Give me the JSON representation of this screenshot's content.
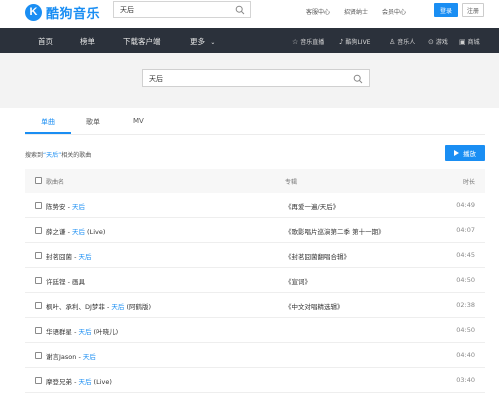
{
  "brand": {
    "logo_glyph": "K",
    "name": "酷狗音乐",
    "color": "#1a8ef3"
  },
  "top_search": {
    "value": "天后",
    "icon": "search-icon"
  },
  "top_links": [
    "客服中心",
    "招贤纳士",
    "会员中心"
  ],
  "auth": {
    "login": "登录",
    "register": "注册"
  },
  "nav": {
    "left": [
      "首页",
      "榜单",
      "下载客户端",
      "更多"
    ],
    "more_icon": "chevron-down-icon",
    "right": [
      {
        "icon": "star-icon",
        "glyph": "☆",
        "label": "音乐直播"
      },
      {
        "icon": "music-note-icon",
        "glyph": "♪",
        "label": "酷狗LIVE"
      },
      {
        "icon": "person-icon",
        "glyph": "♙",
        "label": "音乐人"
      },
      {
        "icon": "gamepad-icon",
        "glyph": "⊙",
        "label": "游戏"
      },
      {
        "icon": "mall-icon",
        "glyph": "▣",
        "label": "商城"
      }
    ]
  },
  "main_search": {
    "value": "天后",
    "icon": "search-icon"
  },
  "tabs": [
    "单曲",
    "歌单",
    "MV"
  ],
  "active_tab": "单曲",
  "result": {
    "prefix": "搜索到",
    "keyword": "“天后”",
    "suffix": "相关的歌曲"
  },
  "play_button": {
    "label": "播放",
    "icon": "play-icon"
  },
  "table": {
    "headers": {
      "song": "歌曲名",
      "album": "专辑",
      "duration": "时长"
    },
    "rows": [
      {
        "song_prefix": "陈势安 - ",
        "song_keyword": "天后",
        "song_suffix": "",
        "album": "《再爱一遍/天后》",
        "duration": "04:49"
      },
      {
        "song_prefix": "薛之谦 - ",
        "song_keyword": "天后",
        "song_suffix": " (Live)",
        "album": "《歌影唱片巡演第二季 第十一期》",
        "duration": "04:07"
      },
      {
        "song_prefix": "封茗囧菌 - ",
        "song_keyword": "天后",
        "song_suffix": "",
        "album": "《封茗囧菌翻唱合辑》",
        "duration": "04:45"
      },
      {
        "song_prefix": "许廷铿 - 画具",
        "song_keyword": "",
        "song_suffix": "",
        "album": "《宣词》",
        "duration": "04:50"
      },
      {
        "song_prefix": "枫叶、承利、DJ梦菲 - ",
        "song_keyword": "天后",
        "song_suffix": " (阿鹤版)",
        "album": "《中文对唱精选辑》",
        "duration": "02:38"
      },
      {
        "song_prefix": "华语群星 - ",
        "song_keyword": "天后",
        "song_suffix": " (叶晓儿)",
        "album": "",
        "duration": "04:50"
      },
      {
        "song_prefix": "谢言Jason - ",
        "song_keyword": "天后",
        "song_suffix": "",
        "album": "",
        "duration": "04:40"
      },
      {
        "song_prefix": "摩登兄弟 - ",
        "song_keyword": "天后",
        "song_suffix": " (Live)",
        "album": "",
        "duration": "03:40"
      }
    ]
  }
}
